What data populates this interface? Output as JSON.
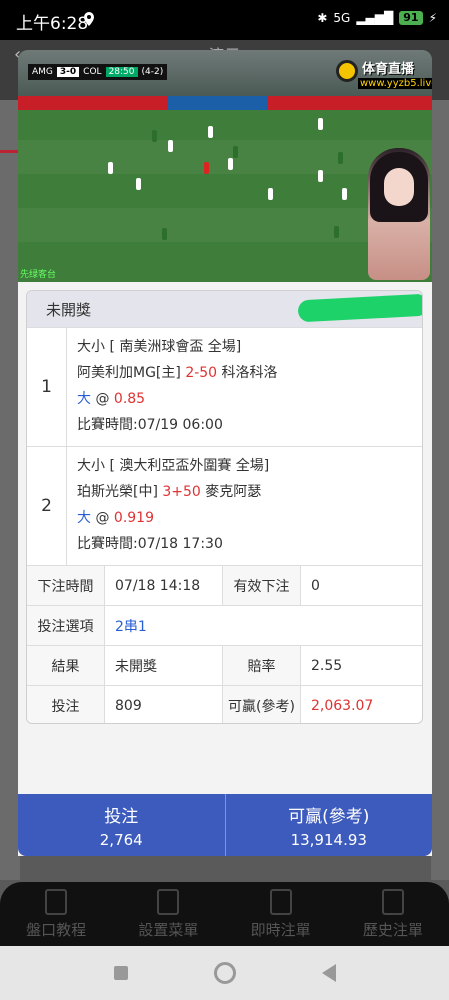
{
  "status_bar": {
    "time": "上午6:28",
    "battery": "91",
    "network": "5G"
  },
  "background_app": {
    "title": "演示"
  },
  "video": {
    "scoreboard": {
      "home": "AMG",
      "score": "3-0",
      "away": "COL",
      "clock": "28:50",
      "agg": "(4-2)"
    },
    "live_logo_name": "体育直播",
    "live_logo_url": "www.yyzb5.live",
    "watermark": "先绿客台"
  },
  "bet": {
    "status": "未開獎",
    "legs": [
      {
        "num": "1",
        "market": "大小 [ 南美洲球會盃 全場]",
        "home": "阿美利加MG[主]",
        "line": "2-50",
        "away": "科洛科洛",
        "pick": "大",
        "at": "@",
        "odds": "0.85",
        "time": "比賽時間:07/19 06:00"
      },
      {
        "num": "2",
        "market": "大小 [ 澳大利亞盃外圍賽 全場]",
        "home": "珀斯光榮[中]",
        "line": "3+50",
        "away": "麥克阿瑟",
        "pick": "大",
        "at": "@",
        "odds": "0.919",
        "time": "比賽時間:07/18 17:30"
      }
    ],
    "details": {
      "bet_time_label": "下注時間",
      "bet_time": "07/18 14:18",
      "valid_label": "有效下注",
      "valid": "0",
      "option_label": "投注選項",
      "option": "2串1",
      "result_label": "結果",
      "result": "未開獎",
      "odds_label": "賠率",
      "odds": "2.55",
      "stake_label": "投注",
      "stake": "809",
      "win_label": "可贏(參考)",
      "win": "2,063.07"
    }
  },
  "summary": {
    "stake_label": "投注",
    "stake": "2,764",
    "win_label": "可贏(參考)",
    "win": "13,914.93"
  },
  "bottom_nav": [
    {
      "label": "盤口教程",
      "icon": "book-icon"
    },
    {
      "label": "設置菜單",
      "icon": "edit-icon"
    },
    {
      "label": "即時注單",
      "icon": "close-doc-icon"
    },
    {
      "label": "歷史注單",
      "icon": "check-doc-icon"
    }
  ],
  "colors": {
    "accent_blue": "#3d5bbd",
    "odds_red": "#d33",
    "pick_blue": "#2a5fd4"
  }
}
